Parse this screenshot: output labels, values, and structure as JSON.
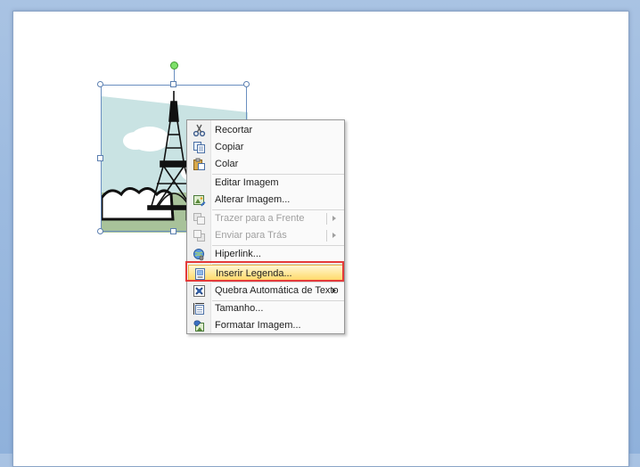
{
  "menu": {
    "items": [
      {
        "label": "Recortar",
        "icon": "scissors-icon",
        "enabled": true
      },
      {
        "label": "Copiar",
        "icon": "copy-icon",
        "enabled": true
      },
      {
        "label": "Colar",
        "icon": "paste-icon",
        "enabled": true
      },
      {
        "label": "Editar Imagem",
        "icon": "",
        "enabled": true
      },
      {
        "label": "Alterar Imagem...",
        "icon": "change-picture-icon",
        "enabled": true
      },
      {
        "label": "Trazer para a Frente",
        "icon": "bring-front-icon",
        "enabled": false,
        "submenu": true
      },
      {
        "label": "Enviar para Trás",
        "icon": "send-back-icon",
        "enabled": false,
        "submenu": true
      },
      {
        "label": "Hiperlink...",
        "icon": "hyperlink-icon",
        "enabled": true
      },
      {
        "label": "Inserir Legenda...",
        "icon": "caption-icon",
        "enabled": true,
        "highlighted": true
      },
      {
        "label": "Quebra Automática de Texto",
        "icon": "text-wrap-icon",
        "enabled": true,
        "submenu": true
      },
      {
        "label": "Tamanho...",
        "icon": "size-icon",
        "enabled": true
      },
      {
        "label": "Formatar Imagem...",
        "icon": "format-picture-icon",
        "enabled": true
      }
    ]
  },
  "colors": {
    "highlight": "#ffe89b",
    "annotation_box": "#e43a3a",
    "sky": "#c9e3e3",
    "ground": "#a8c29a"
  }
}
